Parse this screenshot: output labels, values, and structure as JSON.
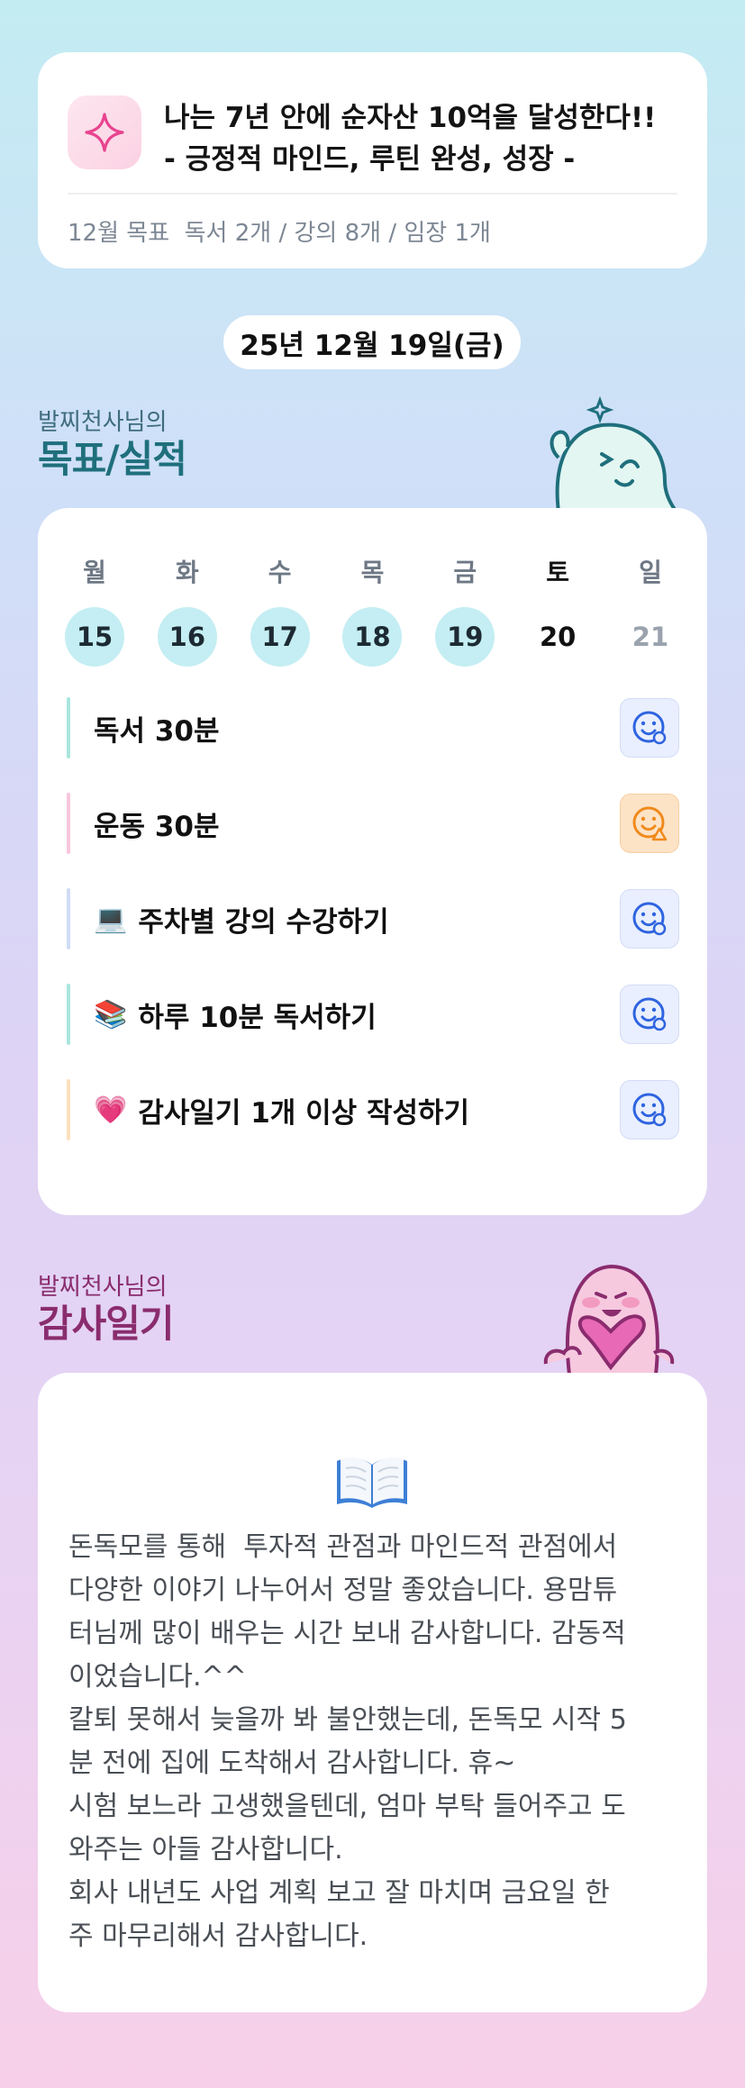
{
  "goal": {
    "icon": "sparkle-icon",
    "title_line1": "나는 7년 안에 순자산 10억을 달성한다!!",
    "title_line2": "- 긍정적 마인드, 루틴 완성, 성장 -",
    "monthly": "12월 목표  독서 2개 / 강의 8개 / 임장 1개"
  },
  "date": "25년 12월 19일(금)",
  "goals_section": {
    "owner": "발찌천사님의",
    "title": "목표/실적",
    "title_color": "#1f6f7c",
    "days": [
      {
        "name": "월",
        "num": "15",
        "state": "done"
      },
      {
        "name": "화",
        "num": "16",
        "state": "done"
      },
      {
        "name": "수",
        "num": "17",
        "state": "done"
      },
      {
        "name": "목",
        "num": "18",
        "state": "done"
      },
      {
        "name": "금",
        "num": "19",
        "state": "done"
      },
      {
        "name": "토",
        "num": "20",
        "state": "today"
      },
      {
        "name": "일",
        "num": "21",
        "state": "future"
      }
    ],
    "tasks": [
      {
        "emoji": "",
        "label": "독서 30분",
        "bar": "#a8e6dd",
        "status": "smile-icon",
        "status_color": "blue"
      },
      {
        "emoji": "",
        "label": "운동 30분",
        "bar": "#f9c6dc",
        "status": "smile-warning-icon",
        "status_color": "orange"
      },
      {
        "emoji": "💻",
        "label": "주차별 강의 수강하기",
        "bar": "#cfdcf5",
        "status": "smile-icon",
        "status_color": "blue"
      },
      {
        "emoji": "📚",
        "label": "하루 10분 독서하기",
        "bar": "#a8e6dd",
        "status": "smile-icon",
        "status_color": "blue"
      },
      {
        "emoji": "💗",
        "label": "감사일기 1개 이상 작성하기",
        "bar": "#fde0bd",
        "status": "smile-icon",
        "status_color": "blue"
      }
    ]
  },
  "gratitude_section": {
    "owner": "발찌천사님의",
    "title": "감사일기",
    "title_color": "#8a2c6e",
    "icon": "open-book-icon",
    "text": "돈독모를 통해  투자적 관점과 마인드적 관점에서\n다양한 이야기 나누어서 정말 좋았습니다. 용맘튜\n터님께 많이 배우는 시간 보내 감사합니다. 감동적\n이었습니다.^^\n칼퇴 못해서 늦을까 봐 불안했는데, 돈독모 시작 5\n분 전에 집에 도착해서 감사합니다. 휴~\n시험 보느라 고생했을텐데, 엄마 부탁 들어주고 도\n와주는 아들 감사합니다.\n회사 내년도 사업 계획 보고 잘 마치며 금요일 한\n주 마무리해서 감사합니다."
  }
}
